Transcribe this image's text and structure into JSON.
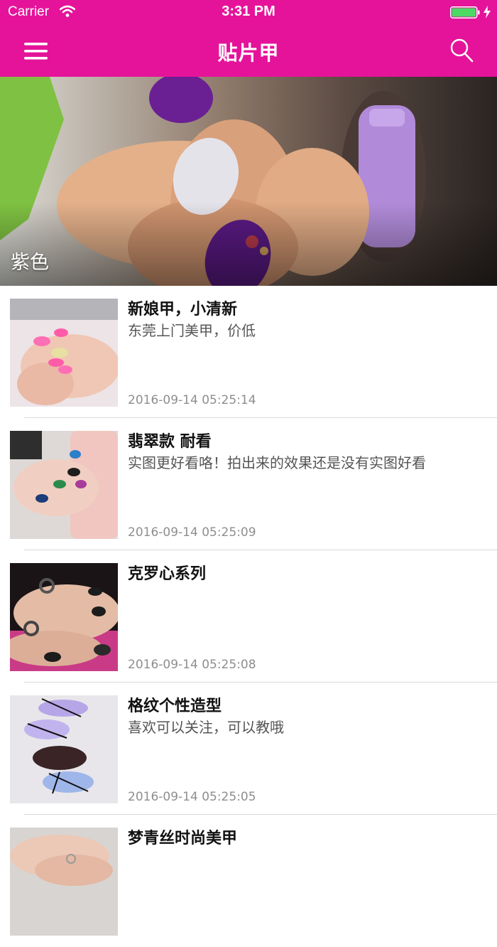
{
  "status_bar": {
    "carrier": "Carrier",
    "time": "3:31 PM",
    "battery_color": "#4cd964"
  },
  "nav": {
    "title": "贴片甲",
    "menu_icon": "hamburger-menu-icon",
    "search_icon": "search-icon"
  },
  "colors": {
    "brand": "#e5139a"
  },
  "hero": {
    "caption": "紫色"
  },
  "posts": [
    {
      "title": "新娘甲，小清新",
      "description": "东莞上门美甲，价低",
      "timestamp": "2016-09-14 05:25:14"
    },
    {
      "title": "翡翠款  耐看",
      "description": "实图更好看咯！拍出来的效果还是没有实图好看",
      "timestamp": "2016-09-14 05:25:09"
    },
    {
      "title": "克罗心系列",
      "description": "",
      "timestamp": "2016-09-14 05:25:08"
    },
    {
      "title": "格纹个性造型",
      "description": "喜欢可以关注，可以教哦",
      "timestamp": "2016-09-14 05:25:05"
    },
    {
      "title": "梦青丝时尚美甲",
      "description": "",
      "timestamp": ""
    }
  ]
}
